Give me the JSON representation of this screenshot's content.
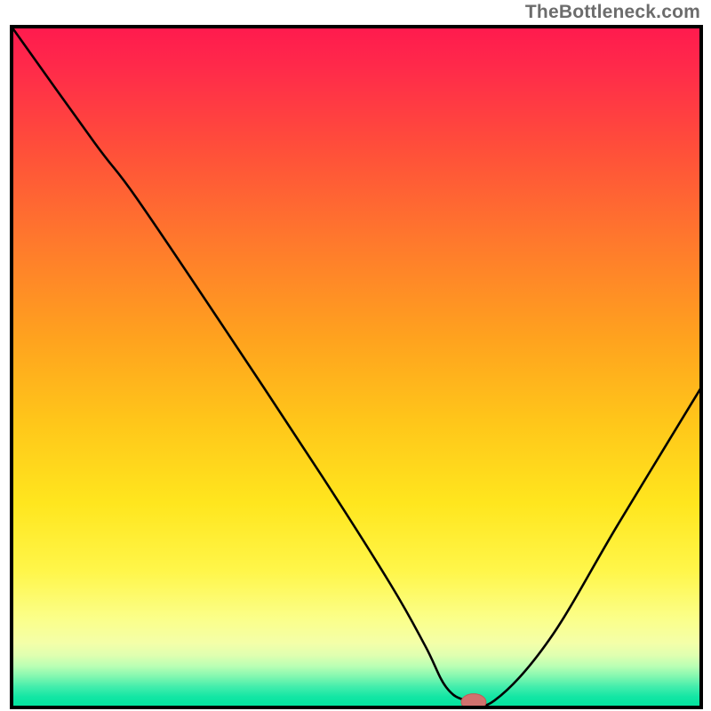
{
  "attribution": "TheBottleneck.com",
  "colors": {
    "border": "#000000",
    "curve": "#000000",
    "marker_fill": "#d1726e",
    "marker_stroke": "#c05a56",
    "gradient_stops": [
      {
        "y": 0.0,
        "color": "#ff1a4e"
      },
      {
        "y": 0.06,
        "color": "#ff2a4a"
      },
      {
        "y": 0.18,
        "color": "#ff4f3a"
      },
      {
        "y": 0.32,
        "color": "#ff7a2c"
      },
      {
        "y": 0.46,
        "color": "#ffa31e"
      },
      {
        "y": 0.58,
        "color": "#ffc61a"
      },
      {
        "y": 0.7,
        "color": "#ffe61e"
      },
      {
        "y": 0.8,
        "color": "#fff64a"
      },
      {
        "y": 0.87,
        "color": "#fbff8a"
      },
      {
        "y": 0.905,
        "color": "#f4ffa8"
      },
      {
        "y": 0.923,
        "color": "#e0ffb0"
      },
      {
        "y": 0.94,
        "color": "#b8ffb4"
      },
      {
        "y": 0.955,
        "color": "#80f7b0"
      },
      {
        "y": 0.97,
        "color": "#42edac"
      },
      {
        "y": 0.985,
        "color": "#12e6a4"
      },
      {
        "y": 1.0,
        "color": "#00e39e"
      }
    ]
  },
  "chart_data": {
    "type": "line",
    "title": "",
    "xlabel": "",
    "ylabel": "",
    "xlim": [
      0,
      100
    ],
    "ylim": [
      0,
      100
    ],
    "series": [
      {
        "name": "bottleneck-curve",
        "x": [
          0,
          12,
          18,
          30,
          45,
          55,
          60,
          63,
          66,
          70,
          78,
          88,
          100
        ],
        "values": [
          100,
          83,
          75,
          57,
          34,
          18,
          9,
          3,
          1,
          1,
          10,
          27,
          47
        ]
      }
    ],
    "marker": {
      "x": 67,
      "y": 0.8,
      "rx": 1.8,
      "ry": 1.2
    }
  }
}
